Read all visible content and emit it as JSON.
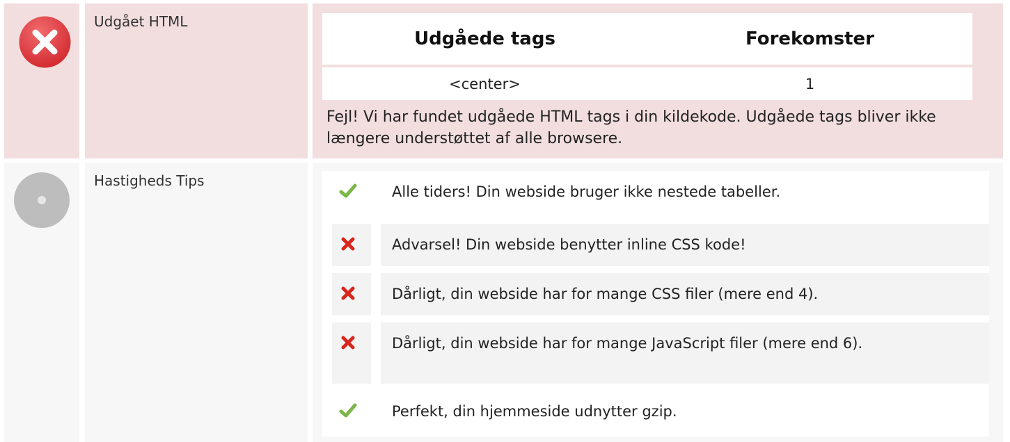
{
  "deprecated": {
    "label": "Udgået HTML",
    "status_icon": "error-x-icon",
    "table": {
      "headers": [
        "Udgåede tags",
        "Forekomster"
      ],
      "rows": [
        [
          "<center>",
          "1"
        ]
      ]
    },
    "message": "Fejl! Vi har fundet udgåede HTML tags i din kildekode. Udgåede tags bliver ikke længere understøttet af alle browsere."
  },
  "speed_tips": {
    "label": "Hastigheds Tips",
    "status_icon": "neutral-circle-icon",
    "items": [
      {
        "status": "ok",
        "icon": "check-icon",
        "text": "Alle tiders! Din webside bruger ikke nestede tabeller."
      },
      {
        "status": "bad",
        "icon": "cross-icon",
        "text": "Advarsel! Din webside benytter inline CSS kode!"
      },
      {
        "status": "bad",
        "icon": "cross-icon",
        "text": "Dårligt, din webside har for mange CSS filer (mere end 4)."
      },
      {
        "status": "bad",
        "icon": "cross-icon",
        "text": "Dårligt, din webside har for mange JavaScript filer (mere end 6)."
      },
      {
        "status": "ok",
        "icon": "check-icon",
        "text": "Perfekt, din hjemmeside udnytter gzip."
      }
    ]
  },
  "colors": {
    "error_row_bg": "#f2dedf",
    "neutral_row_bg": "#f7f7f7",
    "error_red": "#e0393e",
    "check_green": "#7ab648",
    "cross_red": "#d9261c"
  }
}
